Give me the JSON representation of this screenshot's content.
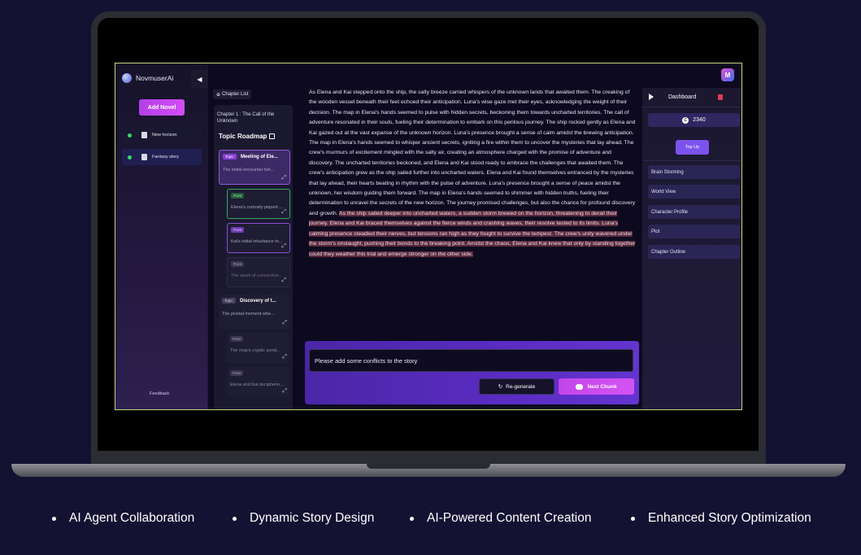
{
  "app": {
    "brand": "NovmuserAi",
    "collapse_icon": "◀",
    "add_novel": "Add Novel",
    "novels": [
      {
        "label": "New horizon"
      },
      {
        "label": "Fantasy story"
      }
    ],
    "feedback": "Feedback",
    "avatar_letter": "M"
  },
  "roadmap": {
    "chapter_list": "Chapter List",
    "chapter_title": "Chapter 1 : The Call of the Unknown",
    "title": "Topic Roadmap",
    "cards": [
      {
        "tag": "Topic",
        "head": "Meeting of Ele...",
        "desc": "The initial encounter bet..."
      },
      {
        "tag": "Point",
        "desc": "Elena's curiosity piqued ..."
      },
      {
        "tag": "Point",
        "desc": "Kai's initial reluctance to..."
      },
      {
        "tag": "Point",
        "desc": "The spark of connection..."
      },
      {
        "tag": "Topic",
        "head": "Discovery of t...",
        "desc": "The pivotal moment whe..."
      },
      {
        "tag": "Point",
        "desc": "The map's cryptic symb..."
      },
      {
        "tag": "Point",
        "desc": "Elena and Kai decipherin..."
      }
    ]
  },
  "story": {
    "normal": "As Elena and Kai stepped onto the ship, the salty breeze carried whispers of the unknown lands that awaited them. The creaking of the wooden vessel beneath their feet echoed their anticipation. Luna's wise gaze met their eyes, acknowledging the weight of their decision. The map in Elena's hands seemed to pulse with hidden secrets, beckoning them towards uncharted territories. The call of adventure resonated in their souls, fueling their determination to embark on this perilous journey.  The ship rocked gently as Elena and Kai gazed out at the vast expanse of the unknown horizon. Luna's presence brought a sense of calm amidst the brewing anticipation. The map in Elena's hands seemed to whisper ancient secrets, igniting a fire within them to uncover the mysteries that lay ahead. The crew's murmurs of excitement mingled with the salty air, creating an atmosphere charged with the promise of adventure and discovery. The uncharted territories beckoned, and Elena and Kai stood ready to embrace the challenges that awaited them.  The crew's anticipation grew as the ship sailed further into uncharted waters. Elena and Kai found themselves entranced by the mysteries that lay ahead, their hearts beating in rhythm with the pulse of adventure. Luna's presence brought a sense of peace amidst the unknown, her wisdom guiding them forward. The map in Elena's hands seemed to shimmer with hidden truths, fueling their determination to unravel the secrets of the new horizon. The journey promised challenges, but also the chance for profound discovery and growth. ",
    "highlighted": "As the ship sailed deeper into uncharted waters, a sudden storm brewed on the horizon, threatening to derail their journey. Elena and Kai braced themselves against the fierce winds and crashing waves, their resolve tested to its limits. Luna's calming presence steadied their nerves, but tensions ran high as they fought to survive the tempest. The crew's unity wavered under the storm's onslaught, pushing their bonds to the breaking point. Amidst the chaos, Elena and Kai knew that only by standing together could they weather this trial and emerge stronger on the other side."
  },
  "prompt": {
    "value": "Please add some conflicts to the story",
    "regenerate": "Re-generate",
    "next_chunk": "Next Chunk"
  },
  "right_panel": {
    "dashboard": "Dashboard",
    "credits": "2340",
    "coin_letter": "C",
    "top_up": "Top Up",
    "tools": [
      "Brain Storming",
      "World View",
      "Character Profile",
      "Plot",
      "Chapter Outline"
    ]
  },
  "features": [
    "AI Agent Collaboration",
    "Dynamic Story Design",
    "AI-Powered Content Creation",
    "Enhanced Story Optimization"
  ],
  "colors": {
    "background": "#141132",
    "accent": "#d24df3",
    "highlight": "#5a2a3e",
    "frame": "#cbd47e"
  }
}
